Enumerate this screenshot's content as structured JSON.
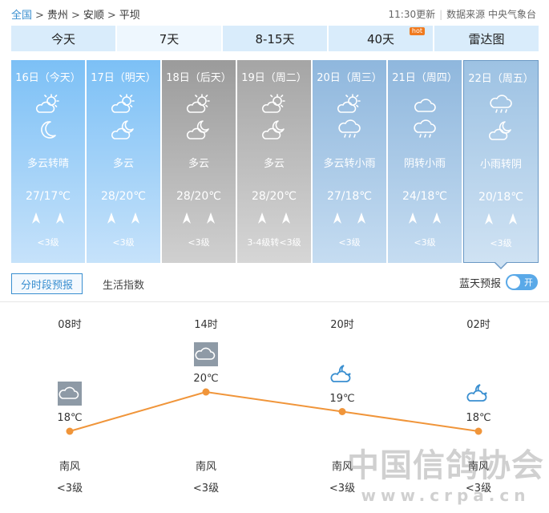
{
  "breadcrumb": {
    "items": [
      "全国",
      "贵州",
      "安顺",
      "平坝"
    ],
    "separator": ">"
  },
  "meta": {
    "update": "11:30更新",
    "source": "数据来源 中央气象台"
  },
  "tabs": [
    {
      "label": "今天"
    },
    {
      "label": "7天"
    },
    {
      "label": "8-15天"
    },
    {
      "label": "40天",
      "badge": "hot"
    },
    {
      "label": "雷达图"
    }
  ],
  "days": [
    {
      "date": "16日（今天）",
      "desc": "多云转晴",
      "temp": "27/17℃",
      "level": "<3级",
      "icon_day": "partly-cloudy-day-icon",
      "icon_night": "moon-icon"
    },
    {
      "date": "17日（明天）",
      "desc": "多云",
      "temp": "28/20℃",
      "level": "<3级",
      "icon_day": "partly-cloudy-day-icon",
      "icon_night": "partly-cloudy-night-icon"
    },
    {
      "date": "18日（后天）",
      "desc": "多云",
      "temp": "28/20℃",
      "level": "<3级",
      "icon_day": "partly-cloudy-day-icon",
      "icon_night": "partly-cloudy-night-icon"
    },
    {
      "date": "19日（周二）",
      "desc": "多云",
      "temp": "28/20℃",
      "level": "3-4级转<3级",
      "icon_day": "partly-cloudy-day-icon",
      "icon_night": "partly-cloudy-night-icon"
    },
    {
      "date": "20日（周三）",
      "desc": "多云转小雨",
      "temp": "27/18℃",
      "level": "<3级",
      "icon_day": "partly-cloudy-day-icon",
      "icon_night": "rain-icon"
    },
    {
      "date": "21日（周四）",
      "desc": "阴转小雨",
      "temp": "24/18℃",
      "level": "<3级",
      "icon_day": "cloud-icon",
      "icon_night": "rain-icon"
    },
    {
      "date": "22日（周五）",
      "desc": "小雨转阴",
      "temp": "20/18℃",
      "level": "<3级",
      "icon_day": "rain-icon",
      "icon_night": "partly-cloudy-night-icon"
    }
  ],
  "subtabs": [
    {
      "label": "分时段预报"
    },
    {
      "label": "生活指数"
    }
  ],
  "bluesky": {
    "label": "蓝天预报",
    "toggle": "开"
  },
  "hourly": {
    "points": [
      {
        "time": "08时",
        "temp": "18℃",
        "temp_value": 18,
        "wind": "南风",
        "level": "<3级",
        "icon": "cloud-icon"
      },
      {
        "time": "14时",
        "temp": "20℃",
        "temp_value": 20,
        "wind": "南风",
        "level": "<3级",
        "icon": "cloud-icon"
      },
      {
        "time": "20时",
        "temp": "19℃",
        "temp_value": 19,
        "wind": "南风",
        "level": "<3级",
        "icon": "cloudy-night-icon"
      },
      {
        "time": "02时",
        "temp": "18℃",
        "temp_value": 18,
        "wind": "南风",
        "level": "<3级",
        "icon": "cloudy-night-icon"
      }
    ],
    "line_color": "#f0953a"
  },
  "watermark": {
    "line1": "中国信鸽协会",
    "line2": "www.crpa.cn"
  }
}
